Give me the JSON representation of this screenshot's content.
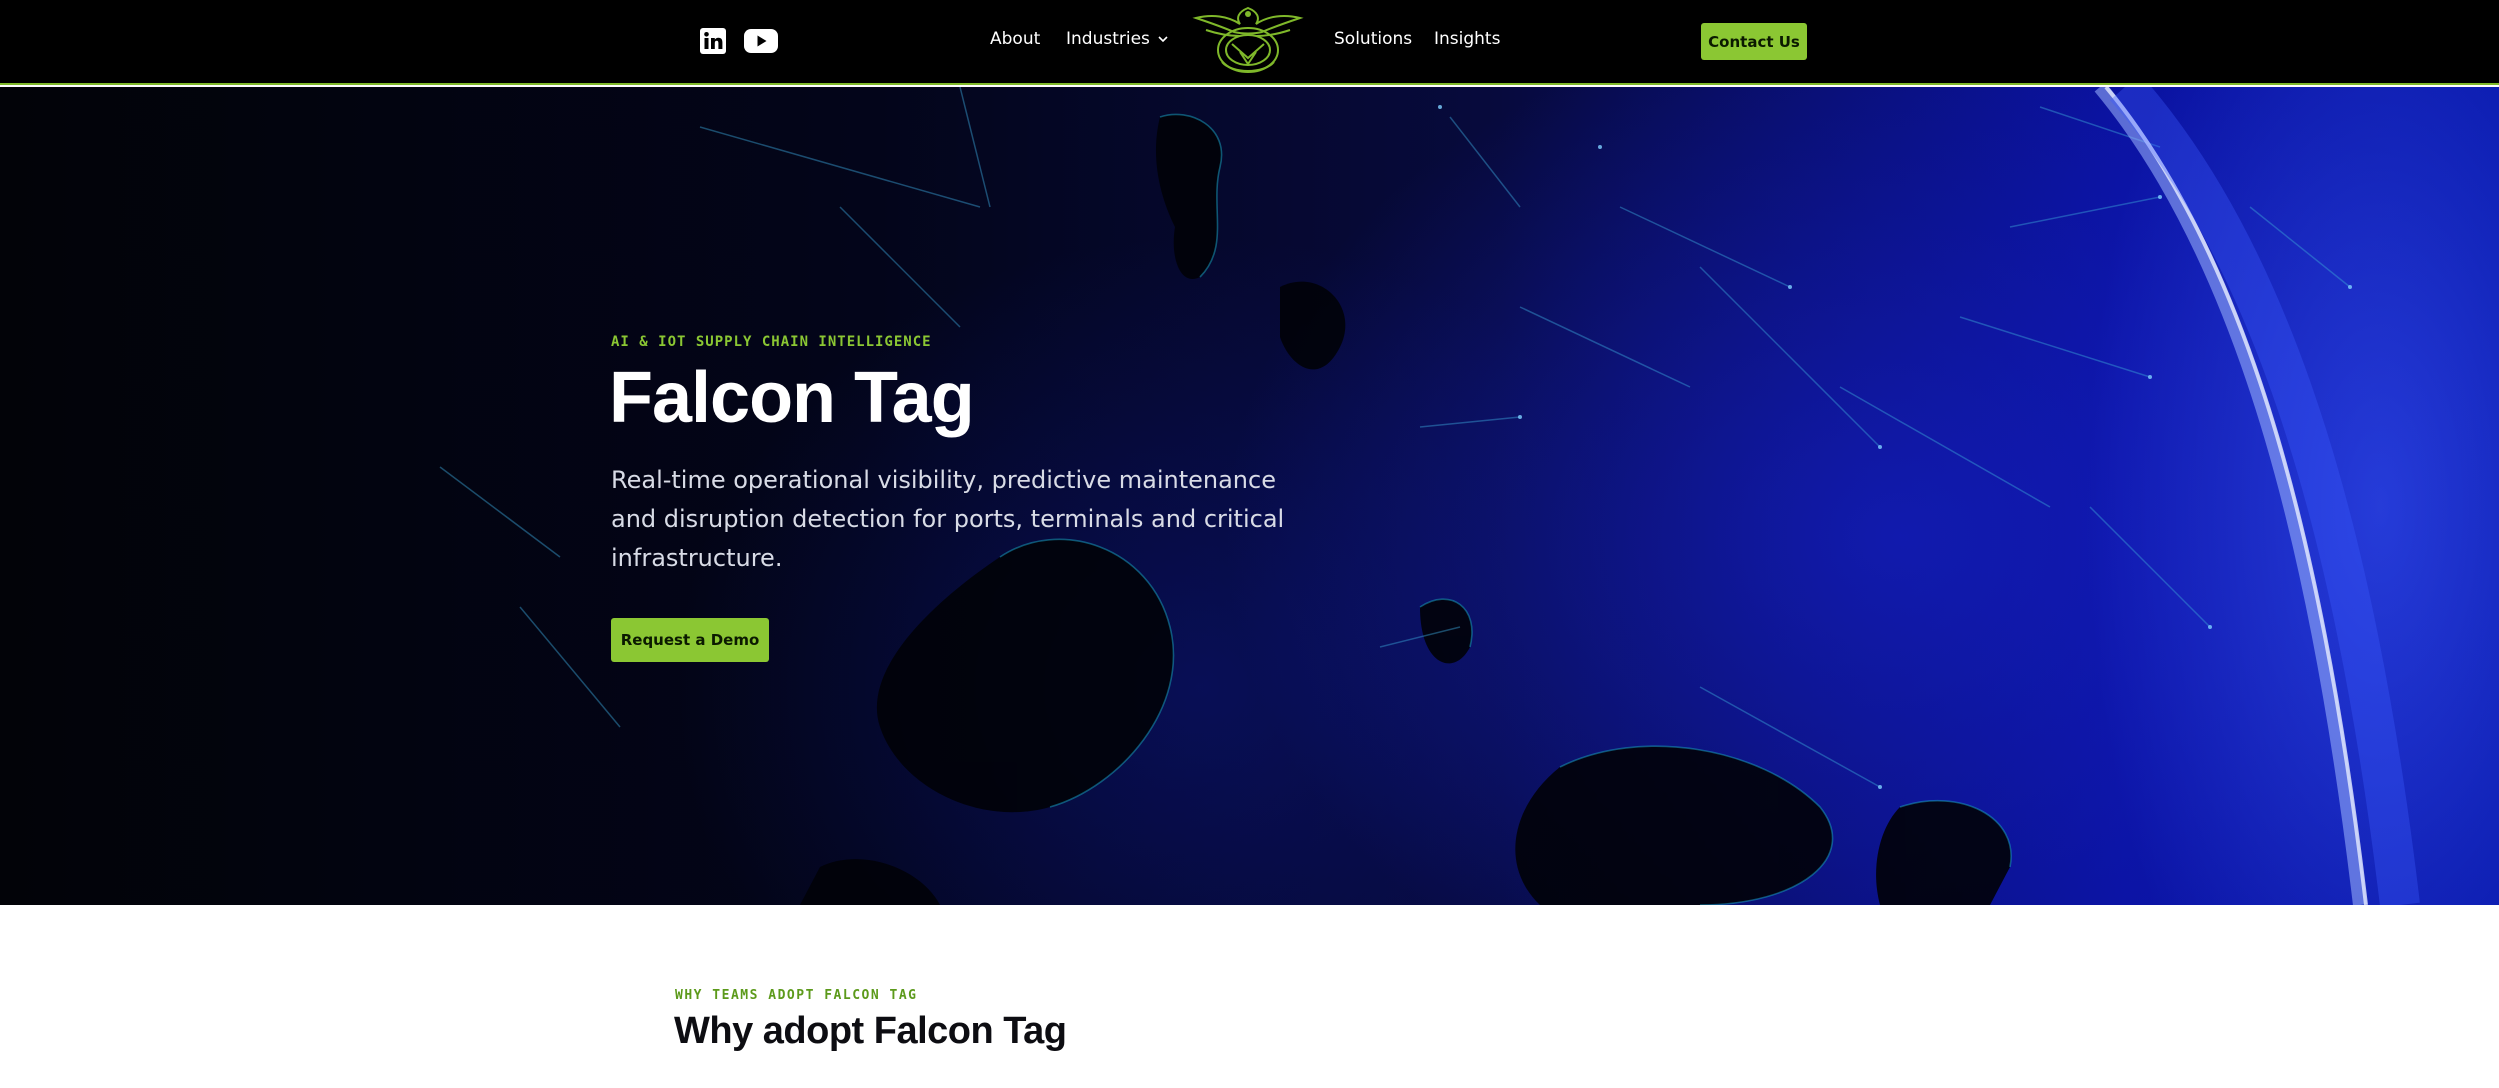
{
  "header": {
    "social": [
      {
        "icon": "linkedin-icon"
      },
      {
        "icon": "youtube-icon"
      }
    ],
    "nav": {
      "about": "About",
      "industries": "Industries",
      "solutions": "Solutions",
      "insights": "Insights"
    },
    "contact_label": "Contact Us"
  },
  "hero": {
    "eyebrow": "AI & IOT SUPPLY CHAIN INTELLIGENCE",
    "title": "Falcon Tag",
    "description": "Real-time operational visibility, predictive maintenance and disruption detection for ports, terminals and critical infrastructure.",
    "cta_label": "Request a Demo"
  },
  "why": {
    "eyebrow": "WHY TEAMS ADOPT FALCON TAG",
    "title": "Why adopt Falcon Tag"
  },
  "colors": {
    "accent": "#8bc733",
    "header_bg": "#000000",
    "hero_blue": "#0a12a0"
  }
}
